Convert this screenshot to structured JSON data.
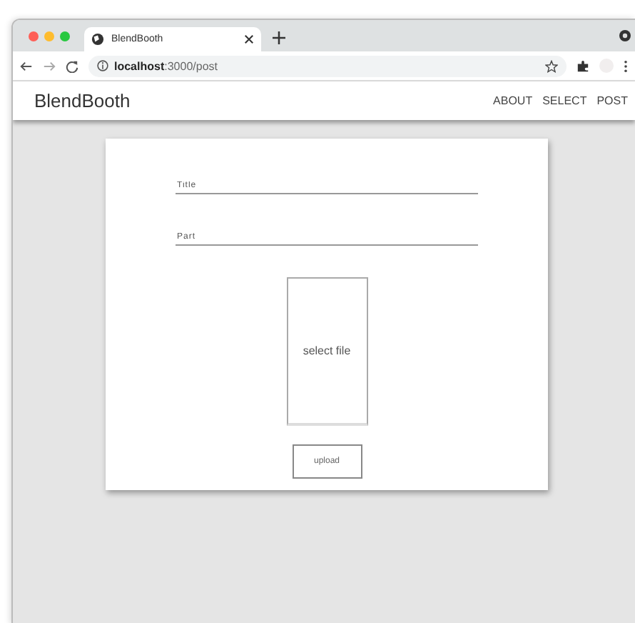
{
  "browser": {
    "tab_title": "BlendBooth",
    "url": "**localhost**:3000/post"
  },
  "header": {
    "brand": "BlendBooth",
    "nav": [
      "ABOUT",
      "SELECT",
      "POST"
    ]
  },
  "form": {
    "fields": [
      {
        "placeholder": "Title"
      },
      {
        "placeholder": "Part"
      }
    ],
    "file_drop": "select file",
    "submit": "upload"
  }
}
